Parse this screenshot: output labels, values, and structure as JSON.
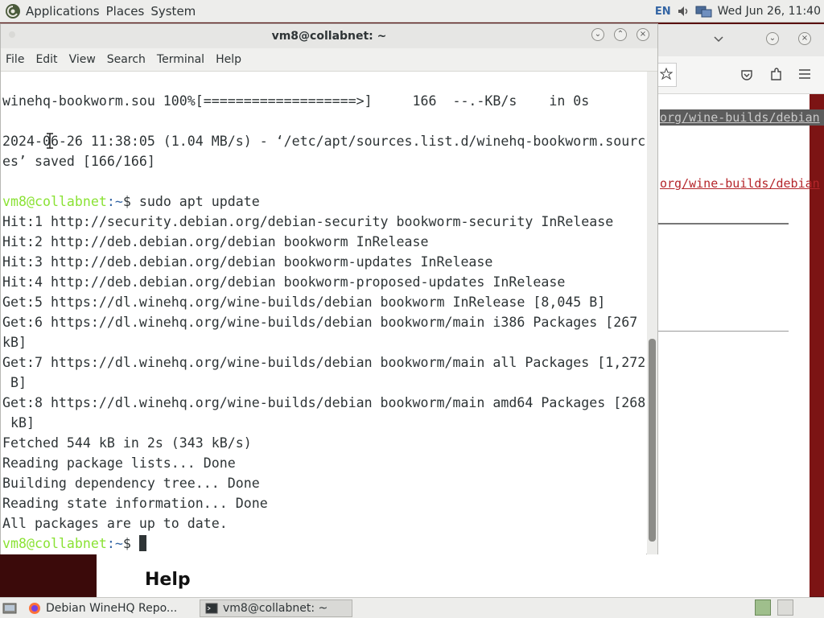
{
  "top_panel": {
    "menus": [
      "Applications",
      "Places",
      "System"
    ],
    "keyboard_layout": "EN",
    "clock": "Wed Jun 26, 11:40"
  },
  "terminal": {
    "title": "vm8@collabnet: ~",
    "menu": [
      "File",
      "Edit",
      "View",
      "Search",
      "Terminal",
      "Help"
    ],
    "lines": [
      "winehq-bookworm.sou 100%[===================>]     166  --.-KB/s    in 0s",
      "",
      "2024-06-26 11:38:05 (1.04 MB/s) - ‘/etc/apt/sources.list.d/winehq-bookworm.sourc",
      "es’ saved [166/166]",
      "",
      "Hit:1 http://security.debian.org/debian-security bookworm-security InRelease",
      "Hit:2 http://deb.debian.org/debian bookworm InRelease",
      "Hit:3 http://deb.debian.org/debian bookworm-updates InRelease",
      "Hit:4 http://deb.debian.org/debian bookworm-proposed-updates InRelease",
      "Get:5 https://dl.winehq.org/wine-builds/debian bookworm InRelease [8,045 B]",
      "Get:6 https://dl.winehq.org/wine-builds/debian bookworm/main i386 Packages [267",
      "kB]",
      "Get:7 https://dl.winehq.org/wine-builds/debian bookworm/main all Packages [1,272",
      " B]",
      "Get:8 https://dl.winehq.org/wine-builds/debian bookworm/main amd64 Packages [268",
      " kB]",
      "Fetched 544 kB in 2s (343 kB/s)",
      "Reading package lists... Done",
      "Building dependency tree... Done",
      "Reading state information... Done",
      "All packages are up to date."
    ],
    "prompt_user": "vm8@collabnet",
    "prompt_path": ":~",
    "prompt_symbol": "$",
    "command": " sudo apt update"
  },
  "browser": {
    "link_1": "org/wine-builds/debian",
    "link_2": "org/wine-builds/debian",
    "help_heading": "Help"
  },
  "taskbar": {
    "tasks": [
      {
        "label": "Debian WineHQ Repo...",
        "active": false
      },
      {
        "label": "vm8@collabnet: ~",
        "active": true
      }
    ]
  }
}
